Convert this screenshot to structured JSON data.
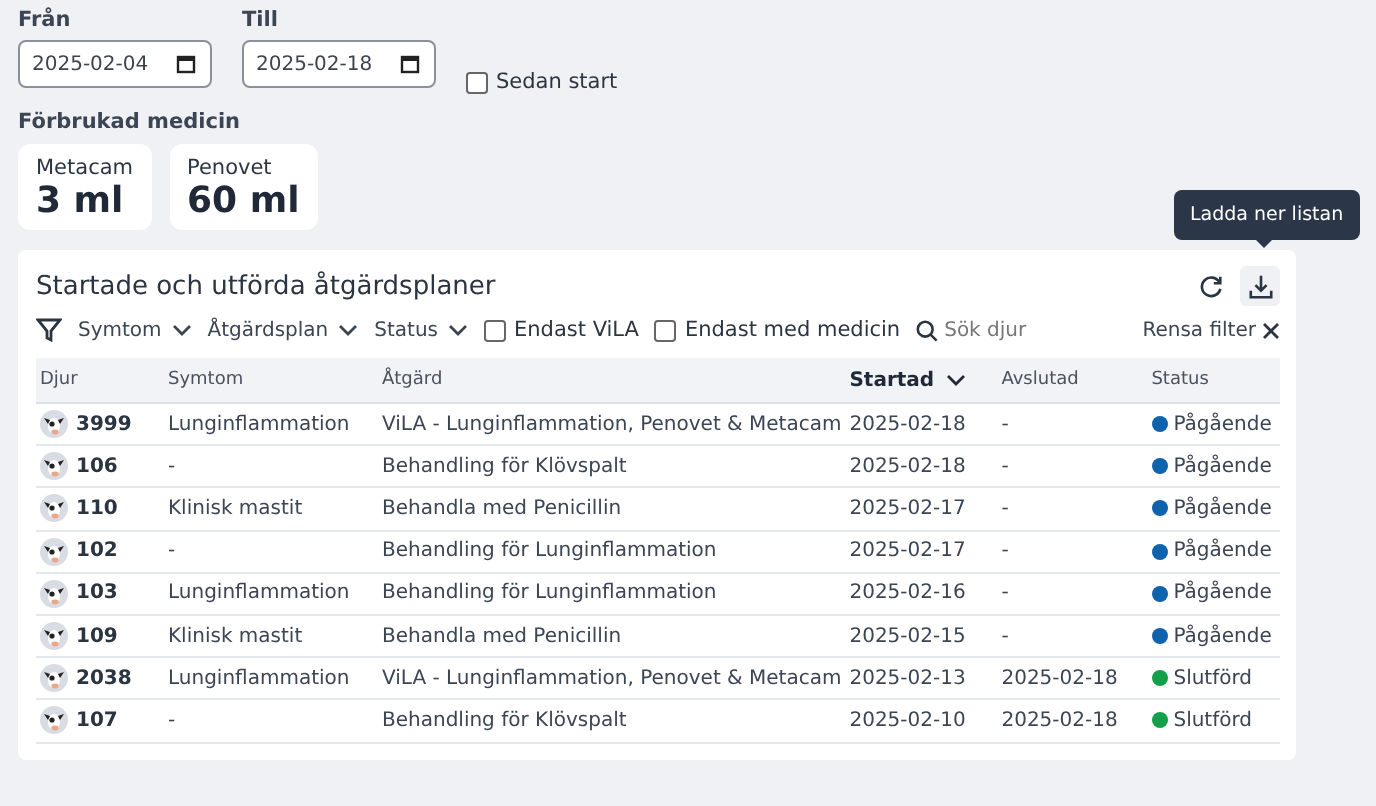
{
  "date_filters": [
    {
      "label": "Från",
      "value": "2025-02-04"
    },
    {
      "label": "Till",
      "value": "2025-02-18"
    }
  ],
  "since_start": {
    "label": "Sedan start",
    "checked": false
  },
  "medicine": {
    "title": "Förbrukad medicin",
    "items": [
      {
        "name": "Metacam",
        "amount": "3 ml"
      },
      {
        "name": "Penovet",
        "amount": "60 ml"
      }
    ]
  },
  "panel": {
    "title": "Startade och utförda åtgärdsplaner",
    "tooltip": "Ladda ner listan",
    "filters": [
      {
        "kind": "dropdown",
        "label": "Symtom"
      },
      {
        "kind": "dropdown",
        "label": "Åtgärdsplan"
      },
      {
        "kind": "dropdown",
        "label": "Status"
      },
      {
        "kind": "checkbox",
        "label": "Endast ViLA",
        "checked": false
      },
      {
        "kind": "checkbox",
        "label": "Endast med medicin",
        "checked": false
      }
    ],
    "search": {
      "placeholder": "Sök djur"
    },
    "clear_filter": "Rensa filter",
    "table": {
      "columns": [
        {
          "label": "Djur",
          "sorted": false
        },
        {
          "label": "Symtom",
          "sorted": false
        },
        {
          "label": "Åtgärd",
          "sorted": false
        },
        {
          "label": "Startad",
          "sorted": true
        },
        {
          "label": "Avslutad",
          "sorted": false
        },
        {
          "label": "Status",
          "sorted": false
        }
      ],
      "rows": [
        {
          "animal": "3999",
          "symptom": "Lunginflammation",
          "action": "ViLA - Lunginflammation, Penovet & Metacam",
          "started": "2025-02-18",
          "ended": "-",
          "status": "Pågående",
          "color": "#0f62ac"
        },
        {
          "animal": "106",
          "symptom": "-",
          "action": "Behandling för Klövspalt",
          "started": "2025-02-18",
          "ended": "-",
          "status": "Pågående",
          "color": "#0f62ac"
        },
        {
          "animal": "110",
          "symptom": "Klinisk mastit",
          "action": "Behandla med Penicillin",
          "started": "2025-02-17",
          "ended": "-",
          "status": "Pågående",
          "color": "#0f62ac"
        },
        {
          "animal": "102",
          "symptom": "-",
          "action": "Behandling för Lunginflammation",
          "started": "2025-02-17",
          "ended": "-",
          "status": "Pågående",
          "color": "#0f62ac"
        },
        {
          "animal": "103",
          "symptom": "Lunginflammation",
          "action": "Behandling för Lunginflammation",
          "started": "2025-02-16",
          "ended": "-",
          "status": "Pågående",
          "color": "#0f62ac"
        },
        {
          "animal": "109",
          "symptom": "Klinisk mastit",
          "action": "Behandla med Penicillin",
          "started": "2025-02-15",
          "ended": "-",
          "status": "Pågående",
          "color": "#0f62ac"
        },
        {
          "animal": "2038",
          "symptom": "Lunginflammation",
          "action": "ViLA - Lunginflammation, Penovet & Metacam",
          "started": "2025-02-13",
          "ended": "2025-02-18",
          "status": "Slutförd",
          "color": "#14a04a"
        },
        {
          "animal": "107",
          "symptom": "-",
          "action": "Behandling för Klövspalt",
          "started": "2025-02-10",
          "ended": "2025-02-18",
          "status": "Slutförd",
          "color": "#14a04a"
        }
      ]
    }
  }
}
